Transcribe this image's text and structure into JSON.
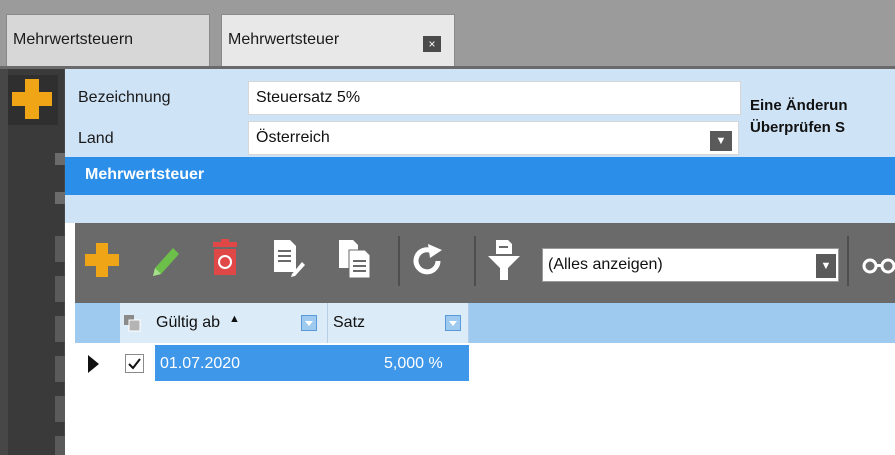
{
  "tabs": [
    {
      "label": "Mehrwertsteuern"
    },
    {
      "label": "Mehrwertsteuer",
      "close": "×"
    }
  ],
  "form": {
    "bezeichnung_label": "Bezeichnung",
    "bezeichnung_value": "Steuersatz 5%",
    "land_label": "Land",
    "land_value": "Österreich",
    "hint_line1": "Eine Änderun",
    "hint_line2": "Überprüfen S"
  },
  "section": {
    "title": "Mehrwertsteuer"
  },
  "toolbar": {
    "filter_value": "(Alles anzeigen)",
    "icons": [
      "add-icon",
      "edit-icon",
      "delete-icon",
      "copy-edit-icon",
      "paste-icon",
      "refresh-icon",
      "filter-icon",
      "glasses-icon"
    ]
  },
  "grid": {
    "columns": [
      {
        "label": "Gültig ab",
        "sort": "ascending"
      },
      {
        "label": "Satz"
      }
    ],
    "rows": [
      {
        "valid_from": "01.07.2020",
        "rate": "5,000 %",
        "checked": true,
        "selected": true
      }
    ]
  },
  "colors": {
    "accent": "#2b8ee8",
    "selection": "#3f97ea",
    "form_bg": "#cfe3f6",
    "toolbar_bg": "#6a6a6a",
    "add": "#f0a516",
    "edit": "#6cc04a",
    "delete": "#e04848"
  }
}
